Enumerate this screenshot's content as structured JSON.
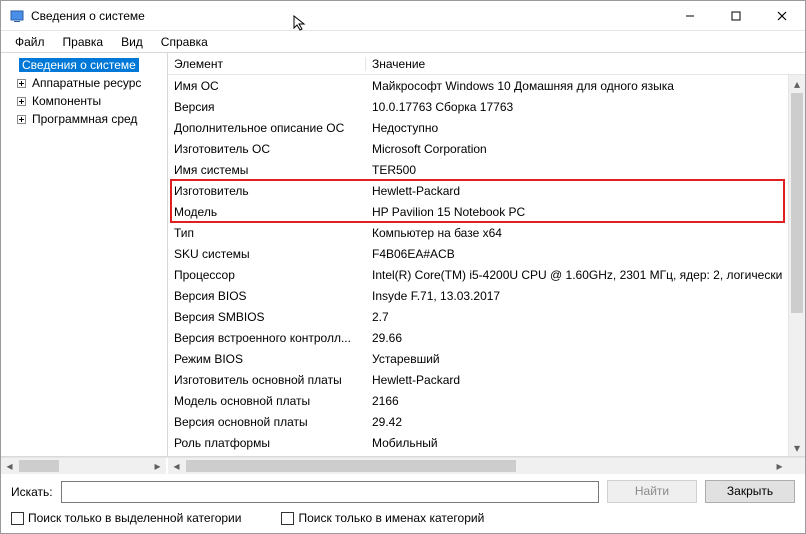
{
  "window": {
    "title": "Сведения о системе"
  },
  "menu": {
    "file": "Файл",
    "edit": "Правка",
    "view": "Вид",
    "help": "Справка"
  },
  "tree": {
    "root": "Сведения о системе",
    "items": [
      "Аппаратные ресурс",
      "Компоненты",
      "Программная сред"
    ]
  },
  "columns": {
    "element": "Элемент",
    "value": "Значение"
  },
  "rows": [
    {
      "k": "Имя ОС",
      "v": "Майкрософт Windows 10 Домашняя для одного языка"
    },
    {
      "k": "Версия",
      "v": "10.0.17763 Сборка 17763"
    },
    {
      "k": "Дополнительное описание ОС",
      "v": "Недоступно"
    },
    {
      "k": "Изготовитель ОС",
      "v": "Microsoft Corporation"
    },
    {
      "k": "Имя системы",
      "v": "TER500"
    },
    {
      "k": "Изготовитель",
      "v": "Hewlett-Packard"
    },
    {
      "k": "Модель",
      "v": "HP Pavilion 15 Notebook PC"
    },
    {
      "k": "Тип",
      "v": "Компьютер на базе x64"
    },
    {
      "k": "SKU системы",
      "v": "F4B06EA#ACB"
    },
    {
      "k": "Процессор",
      "v": "Intel(R) Core(TM) i5-4200U CPU @ 1.60GHz, 2301 МГц, ядер: 2, логически"
    },
    {
      "k": "Версия BIOS",
      "v": "Insyde F.71, 13.03.2017"
    },
    {
      "k": "Версия SMBIOS",
      "v": "2.7"
    },
    {
      "k": "Версия встроенного контролл...",
      "v": "29.66"
    },
    {
      "k": "Режим BIOS",
      "v": "Устаревший"
    },
    {
      "k": "Изготовитель основной платы",
      "v": "Hewlett-Packard"
    },
    {
      "k": "Модель основной платы",
      "v": "2166"
    },
    {
      "k": "Версия основной платы",
      "v": "29.42"
    },
    {
      "k": "Роль платформы",
      "v": "Мобильный"
    }
  ],
  "highlight": {
    "start": 5,
    "end": 6
  },
  "footer": {
    "searchLabel": "Искать:",
    "findBtn": "Найти",
    "closeBtn": "Закрыть",
    "chk1": "Поиск только в выделенной категории",
    "chk2": "Поиск только в именах категорий"
  }
}
